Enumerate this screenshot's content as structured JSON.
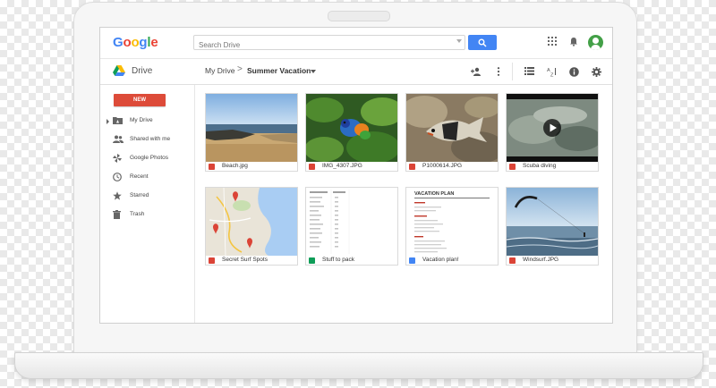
{
  "app": {
    "logo_letters": [
      "G",
      "o",
      "o",
      "g",
      "l",
      "e"
    ],
    "product": "Drive"
  },
  "search": {
    "placeholder": "Search Drive"
  },
  "breadcrumb": {
    "root": "My Drive",
    "separator": ">",
    "current": "Summer Vacation"
  },
  "toolbar": {
    "icons": [
      "add-person-icon",
      "more-vert-icon",
      "list-view-icon",
      "sort-az-icon",
      "info-icon",
      "settings-icon"
    ]
  },
  "header_icons": [
    "apps-icon",
    "notifications-icon",
    "account-avatar"
  ],
  "sidebar": {
    "new_label": "NEW",
    "items": [
      {
        "label": "My Drive",
        "icon": "drive-folder-icon"
      },
      {
        "label": "Shared with me",
        "icon": "people-icon"
      },
      {
        "label": "Google Photos",
        "icon": "pinwheel-icon"
      },
      {
        "label": "Recent",
        "icon": "clock-icon"
      },
      {
        "label": "Starred",
        "icon": "star-icon"
      },
      {
        "label": "Trash",
        "icon": "trash-icon"
      }
    ]
  },
  "files": [
    {
      "name": "Beach.jpg",
      "type": "image",
      "icon_color": "#db4437"
    },
    {
      "name": "IMG_4307.JPG",
      "type": "image",
      "icon_color": "#db4437"
    },
    {
      "name": "P1000614.JPG",
      "type": "image",
      "icon_color": "#db4437"
    },
    {
      "name": "Scuba diving",
      "type": "video",
      "icon_color": "#db4437"
    },
    {
      "name": "Secret Surf Spots",
      "type": "map",
      "icon_color": "#db4437"
    },
    {
      "name": "Stuff to pack",
      "type": "sheet",
      "icon_color": "#0f9d58"
    },
    {
      "name": "Vacation plan!",
      "type": "doc",
      "icon_color": "#4285f4"
    },
    {
      "name": "Windsurf.JPG",
      "type": "image",
      "icon_color": "#db4437"
    }
  ],
  "doc_preview": {
    "title": "VACATION PLAN"
  },
  "colors": {
    "accent": "#4285f4",
    "new_button": "#dd4b39",
    "avatar": "#43a047"
  }
}
